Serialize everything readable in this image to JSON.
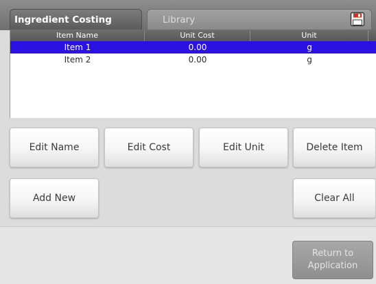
{
  "tabs": {
    "active": "Ingredient Costing",
    "inactive": "Library"
  },
  "table": {
    "columns": [
      "Item Name",
      "Unit Cost",
      "Unit"
    ],
    "rows": [
      {
        "name": "Item 1",
        "cost": "0.00",
        "unit": "g",
        "selected": true
      },
      {
        "name": "Item 2",
        "cost": "0.00",
        "unit": "g",
        "selected": false
      }
    ]
  },
  "buttons": {
    "edit_name": "Edit Name",
    "edit_cost": "Edit Cost",
    "edit_unit": "Edit Unit",
    "delete_item": "Delete Item",
    "add_new": "Add New",
    "clear_all": "Clear All",
    "return_to_application": "Return to\nApplication"
  },
  "icons": {
    "save": "floppy-disk-icon"
  },
  "colors": {
    "selection": "#2b12e3",
    "title_bar": "#7a7a7a",
    "disabled_button": "#9a9a9a"
  }
}
